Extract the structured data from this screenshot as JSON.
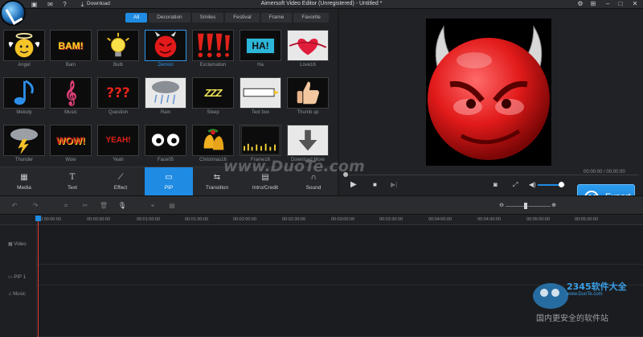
{
  "titlebar": {
    "title": "Aimersoft Video Editor (Unregistered) - Untitled *",
    "download_label": "Download",
    "icons": [
      "save-icon",
      "message-icon",
      "help-icon",
      "download-icon"
    ],
    "right_icons": [
      "gear-icon",
      "cart-icon",
      "minimize-icon",
      "maximize-icon",
      "close-icon"
    ]
  },
  "tabs": [
    "All",
    "Decoration",
    "Smiles",
    "Festival",
    "Frame",
    "Favorite"
  ],
  "tiles": [
    {
      "label": "Angel",
      "icon": "angel-icon"
    },
    {
      "label": "Bam",
      "icon": "bam-icon"
    },
    {
      "label": "Bulb",
      "icon": "bulb-icon"
    },
    {
      "label": "Demon",
      "icon": "demon-icon"
    },
    {
      "label": "Exclamation",
      "icon": "exclamation-icon"
    },
    {
      "label": "Ha",
      "icon": "ha-icon"
    },
    {
      "label": "Love16",
      "icon": "love-icon"
    },
    {
      "label": "Melody",
      "icon": "melody-icon"
    },
    {
      "label": "Music",
      "icon": "music-icon"
    },
    {
      "label": "Question",
      "icon": "question-icon"
    },
    {
      "label": "Rain",
      "icon": "rain-icon"
    },
    {
      "label": "Sleep",
      "icon": "sleep-icon"
    },
    {
      "label": "Text box",
      "icon": "textbox-icon"
    },
    {
      "label": "Thumb up",
      "icon": "thumb-up-icon"
    },
    {
      "label": "Thunder",
      "icon": "thunder-icon"
    },
    {
      "label": "Wow",
      "icon": "wow-icon"
    },
    {
      "label": "Yeah",
      "icon": "yeah-icon"
    },
    {
      "label": "Face05",
      "icon": "face-icon"
    },
    {
      "label": "Christmas16",
      "icon": "bells-icon"
    },
    {
      "label": "Frame16",
      "icon": "frame-icon"
    },
    {
      "label": "Download More",
      "icon": "download-arrow-icon"
    }
  ],
  "tile_text": {
    "bam": "BAM!",
    "ha": "HA!",
    "question": "???",
    "sleep": "ZZZ",
    "wow": "WOW!",
    "yeah": "YEAH!"
  },
  "selected_tile": "Demon",
  "categories": [
    {
      "label": "Media",
      "icon": "film-icon"
    },
    {
      "label": "Text",
      "icon": "text-icon"
    },
    {
      "label": "Effect",
      "icon": "wand-icon"
    },
    {
      "label": "PIP",
      "icon": "pip-icon"
    },
    {
      "label": "Transition",
      "icon": "transition-icon"
    },
    {
      "label": "Intro/Credit",
      "icon": "intro-credit-icon"
    },
    {
      "label": "Sound",
      "icon": "headphones-icon"
    }
  ],
  "active_category": "PIP",
  "preview": {
    "time": "00:00:00 / 00:00:00",
    "volume_level": 0.85
  },
  "export": {
    "label": "Export"
  },
  "timeline": {
    "ticks": [
      "0:00:00:00",
      "00:00:30:00",
      "00:01:00:00",
      "00:01:30:00",
      "00:02:00:00",
      "00:02:30:00",
      "00:03:00:00",
      "00:03:30:00",
      "00:04:00:00",
      "00:04:30:00",
      "00:05:00:00",
      "00:05:30:00"
    ],
    "tracks": [
      "Video",
      "PIP 1",
      "Music"
    ],
    "zoom_level": 0.45
  },
  "watermarks": {
    "site": "www.DuoTe.com",
    "brand": "2345软件大全",
    "brand_url": "www.DuoTe.com",
    "slogan": "国内更安全的软件站"
  },
  "colors": {
    "accent": "#1f8be3",
    "playhead": "#e23b3b",
    "demon_red": "#e21a1a"
  }
}
